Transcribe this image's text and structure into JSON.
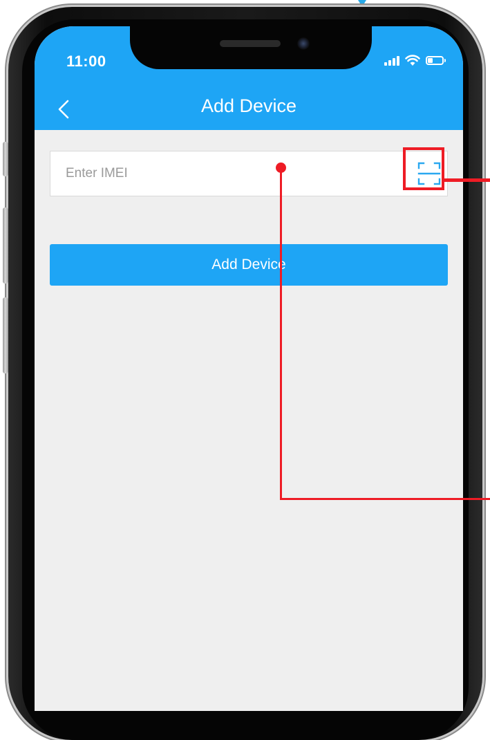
{
  "status_bar": {
    "time": "11:00",
    "icons": [
      "signal-icon",
      "wifi-icon",
      "battery-icon"
    ]
  },
  "nav": {
    "title": "Add Device",
    "back_icon": "chevron-left-icon"
  },
  "imei": {
    "placeholder": "Enter IMEI",
    "value": "",
    "scan_icon": "qr-scan-icon"
  },
  "add_button": {
    "label": "Add Device"
  },
  "colors": {
    "primary": "#1ea5f5",
    "background": "#efefef",
    "annotation": "#ee1c25",
    "frame": "#0d0d0d"
  }
}
